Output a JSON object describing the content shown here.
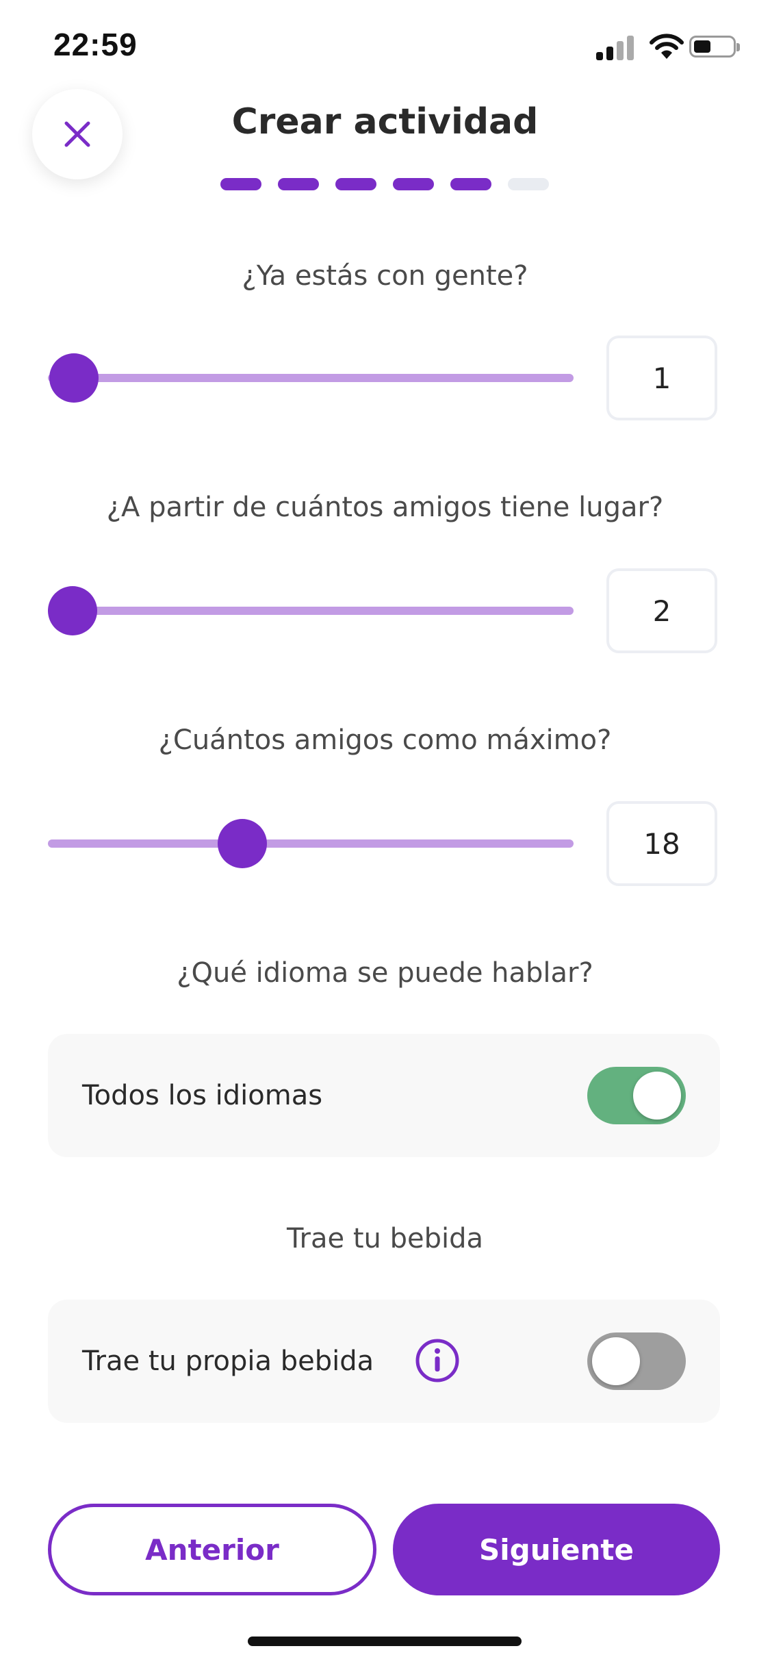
{
  "status_bar": {
    "time": "22:59",
    "icons": [
      "signal-icon",
      "wifi-icon",
      "battery-icon"
    ]
  },
  "header": {
    "close_icon": "close-icon",
    "title": "Crear actividad",
    "progress": {
      "total_steps": 6,
      "current_step": 5
    }
  },
  "form": {
    "group_size": {
      "label": "¿Ya estás con gente?",
      "value": "1",
      "slider_fraction": 0.05
    },
    "min_friends": {
      "label": "¿A partir de cuántos amigos tiene lugar?",
      "value": "2",
      "slider_fraction": 0.03
    },
    "max_friends": {
      "label": "¿Cuántos amigos como máximo?",
      "value": "18",
      "slider_fraction": 0.37
    },
    "language": {
      "label": "¿Qué idioma se puede hablar?",
      "toggle_label": "Todos los idiomas",
      "enabled": true
    },
    "drink": {
      "label": "Trae tu bebida",
      "toggle_label": "Trae tu propia bebida",
      "info_icon": "info-icon",
      "enabled": false
    }
  },
  "footer": {
    "prev_label": "Anterior",
    "next_label": "Siguiente"
  },
  "colors": {
    "accent": "#7a2cc7",
    "track": "#c29be4",
    "toggle_on": "#63b17f",
    "toggle_off": "#9e9e9e"
  }
}
